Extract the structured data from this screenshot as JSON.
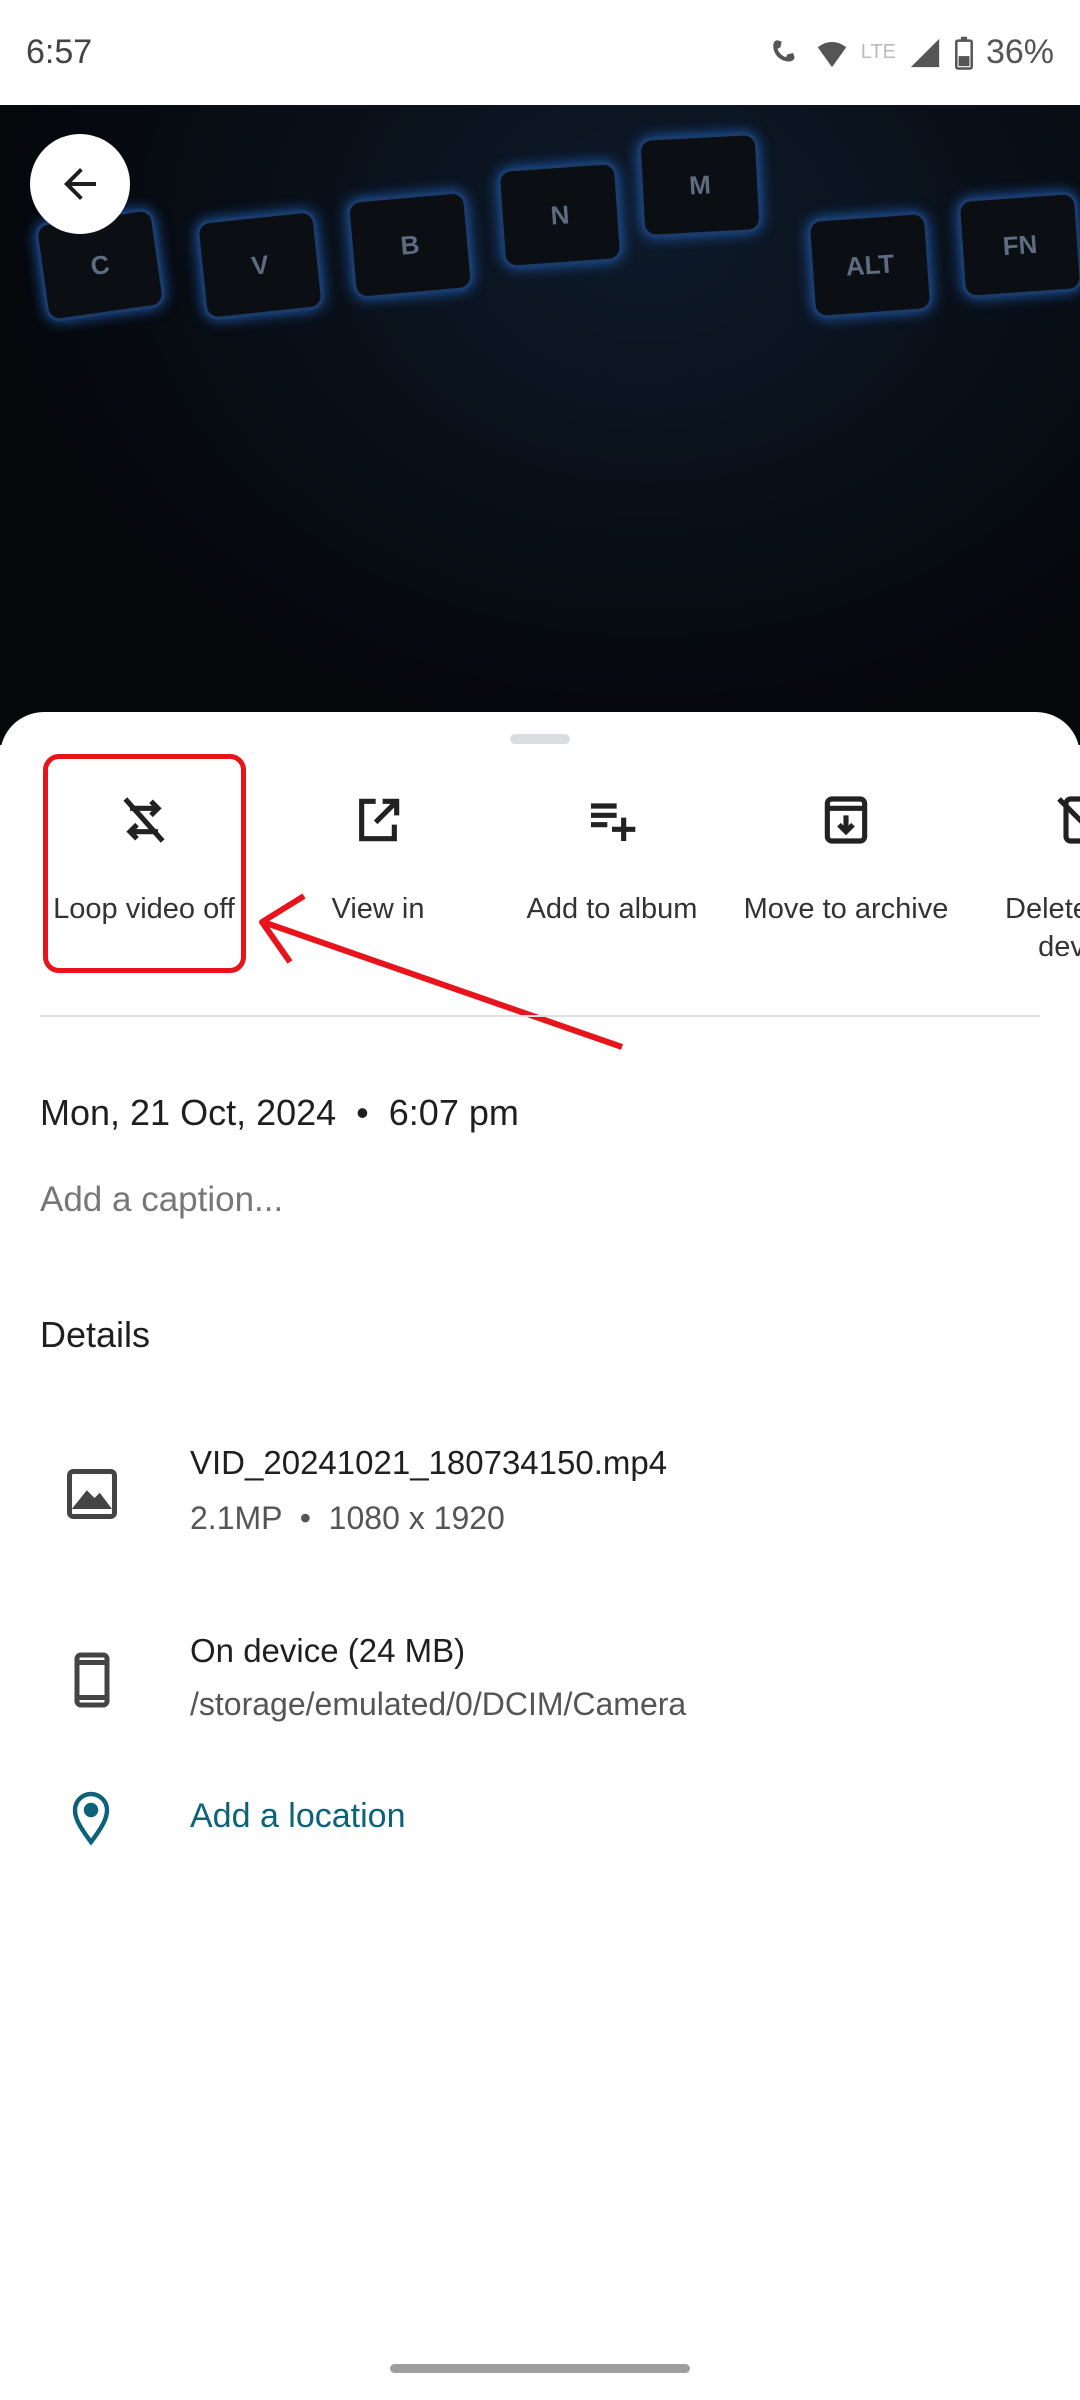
{
  "status_bar": {
    "time": "6:57",
    "network": "LTE",
    "battery": "36%"
  },
  "video": {
    "keys": [
      "C",
      "V",
      "B",
      "N",
      "M",
      "ALT",
      "FN"
    ]
  },
  "actions": [
    {
      "label": "Loop video off",
      "icon": "repeat-off-icon"
    },
    {
      "label": "View in",
      "icon": "open-in-new-icon"
    },
    {
      "label": "Add to album",
      "icon": "playlist-add-icon"
    },
    {
      "label": "Move to archive",
      "icon": "archive-icon"
    },
    {
      "label": "Delete from device",
      "icon": "mobile-off-icon"
    }
  ],
  "annotation_color": "#e8141b",
  "info": {
    "datetime": "Mon, 21 Oct, 2024  •  6:07 pm",
    "caption_placeholder": "Add a caption...",
    "details_heading": "Details",
    "file_name": "VID_20241021_180734150.mp4",
    "file_meta": "2.1MP  •  1080 x 1920",
    "storage": "On device (24 MB)",
    "path": "/storage/emulated/0/DCIM/Camera",
    "location": "Add a location"
  },
  "accent_color": "#0b6279"
}
